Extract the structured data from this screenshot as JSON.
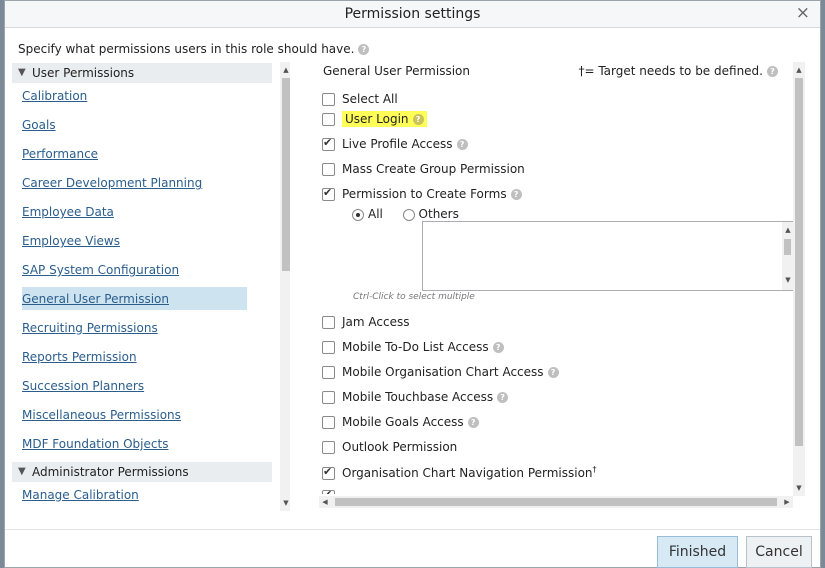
{
  "dialog": {
    "title": "Permission settings",
    "close_glyph": "×",
    "description": "Specify what permissions users in this role should have.",
    "help_glyph": "?"
  },
  "left": {
    "user_section_title": "User Permissions",
    "admin_section_title": "Administrator Permissions",
    "links": [
      "Calibration",
      "Goals",
      "Performance",
      "Career Development Planning",
      "Employee Data",
      "Employee Views",
      "SAP System Configuration",
      "General User Permission",
      "Recruiting Permissions",
      "Reports Permission",
      "Succession Planners",
      "Miscellaneous Permissions",
      "MDF Foundation Objects"
    ],
    "active_link": "General User Permission",
    "admin_links": [
      "Manage Calibration"
    ]
  },
  "right": {
    "title": "General User Permission",
    "target_note": "†= Target needs to be defined.",
    "select_all": "Select All",
    "user_login": "User Login",
    "live_profile": "Live Profile Access",
    "mass_create": "Mass Create Group Permission",
    "create_forms": "Permission to Create Forms",
    "radio_all": "All",
    "radio_others": "Others",
    "hint": "Ctrl-Click to select multiple",
    "jam": "Jam Access",
    "mobile_todo": "Mobile To-Do List Access",
    "mobile_org": "Mobile Organisation Chart Access",
    "mobile_touchbase": "Mobile Touchbase Access",
    "mobile_goals": "Mobile Goals Access",
    "outlook": "Outlook Permission",
    "org_nav": "Organisation Chart Navigation Permission",
    "dagger": "†"
  },
  "footer": {
    "finished": "Finished",
    "cancel": "Cancel"
  },
  "colors": {
    "highlight": "#ffff57",
    "link": "#2a5d8c",
    "active_bg": "#cde3f0"
  }
}
